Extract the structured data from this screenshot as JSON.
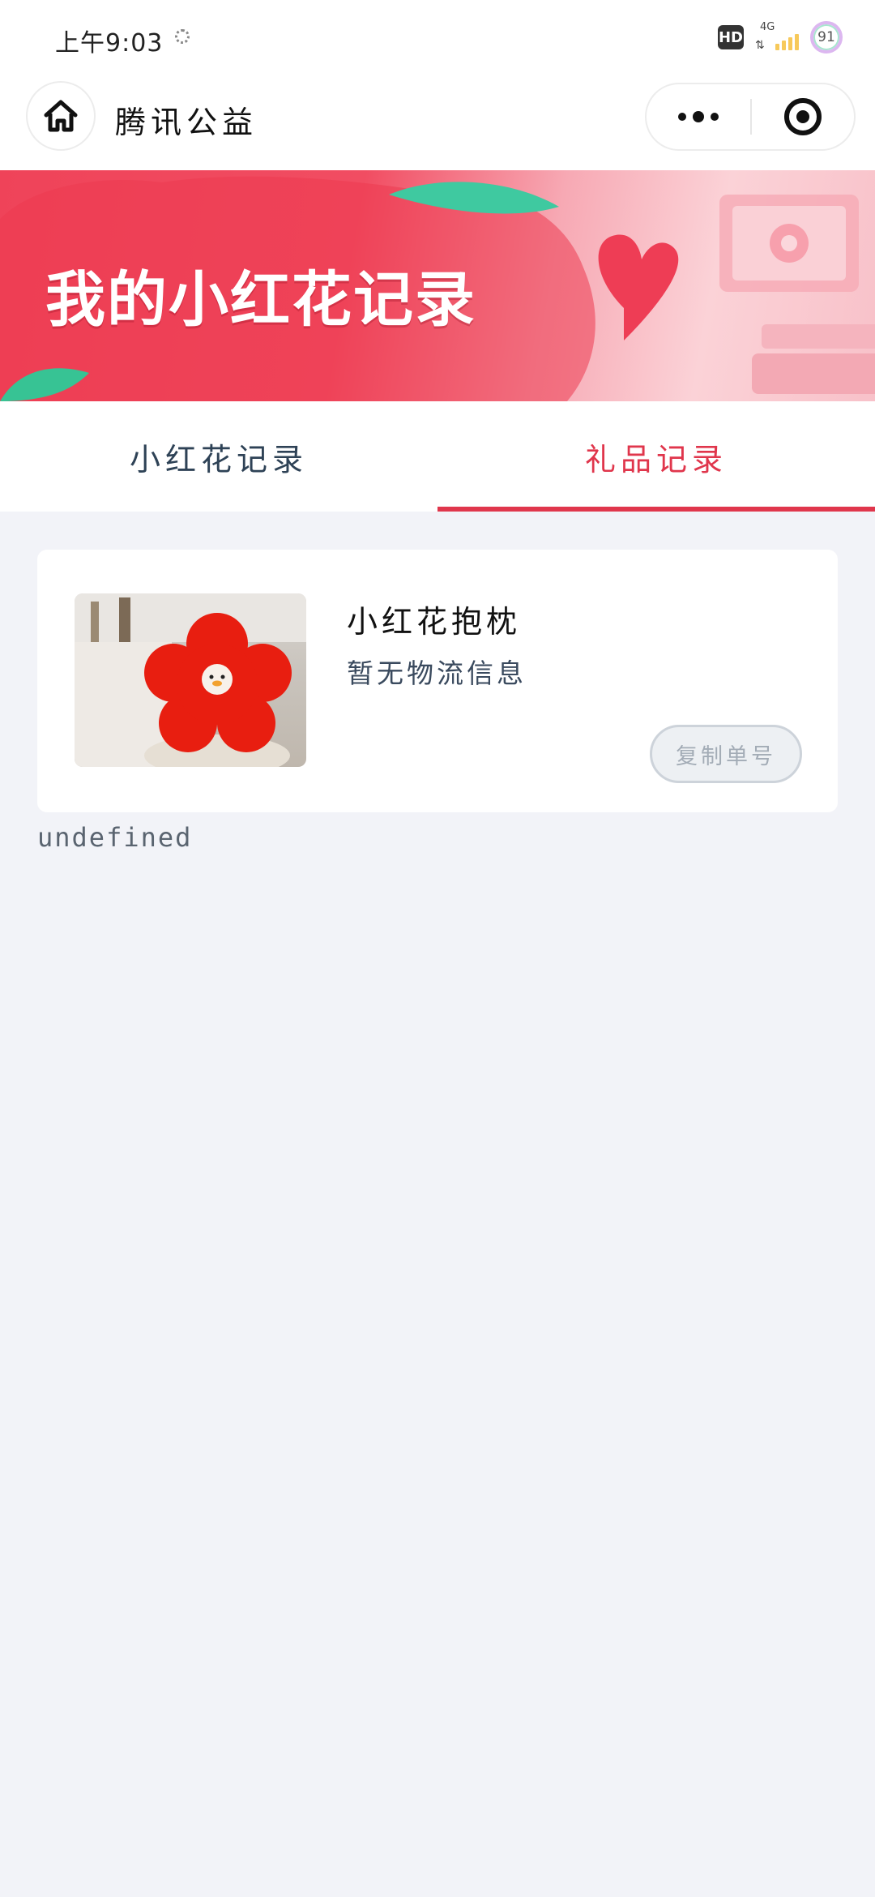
{
  "status_bar": {
    "time": "上午9:03",
    "hd": "HD",
    "network": "4G",
    "battery": "91"
  },
  "nav": {
    "title": "腾讯公益",
    "icons": [
      "home-icon",
      "more-icon",
      "close-mini-program-icon"
    ]
  },
  "banner": {
    "title": "我的小红花记录"
  },
  "tabs": [
    {
      "label": "小红花记录",
      "active": false
    },
    {
      "label": "礼品记录",
      "active": true
    }
  ],
  "gift_card": {
    "name": "小红花抱枕",
    "logistics": "暂无物流信息",
    "copy_button": "复制单号"
  },
  "footer_text": "undefined",
  "colors": {
    "accent": "#e0364c",
    "background": "#f2f3f8",
    "tab_text": "#2e4256"
  }
}
